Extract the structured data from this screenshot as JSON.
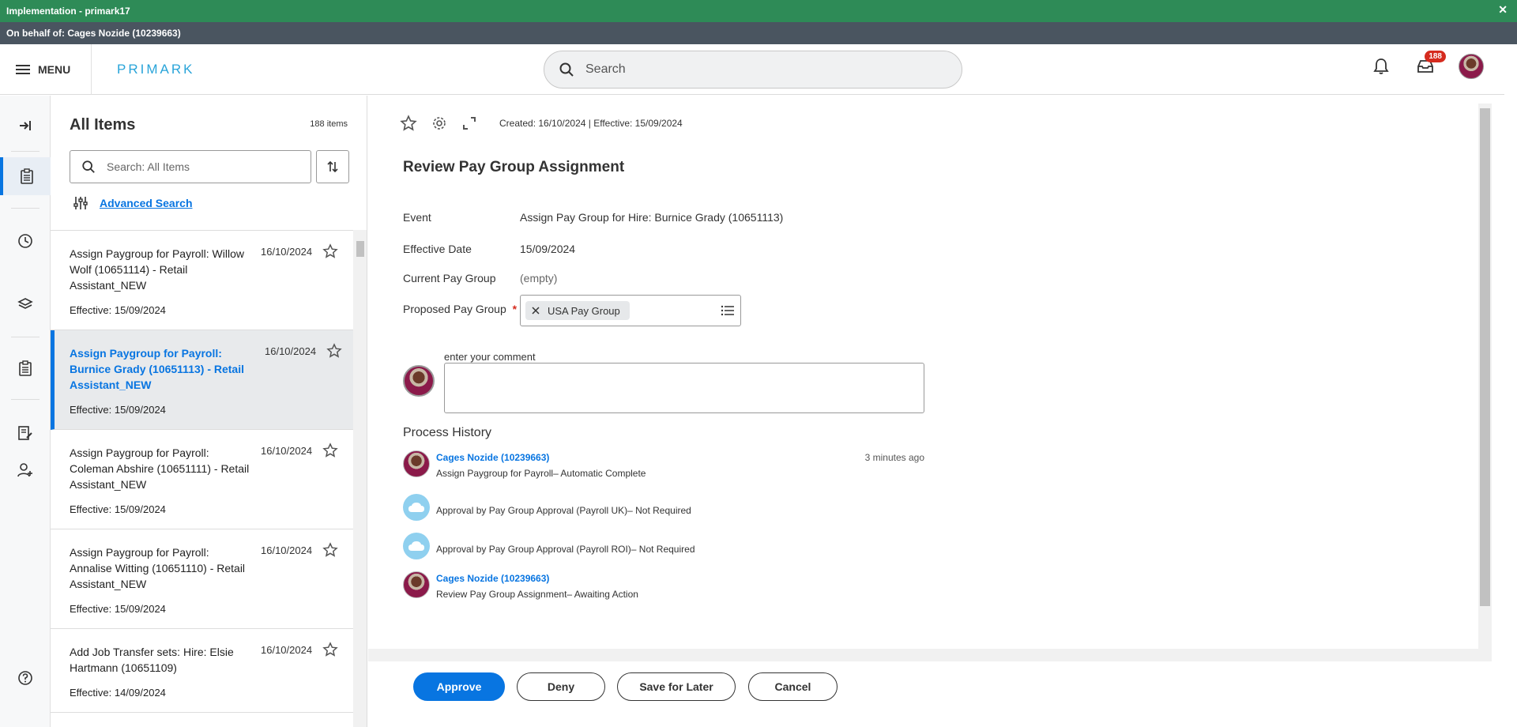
{
  "env": {
    "title": "Implementation - primark17",
    "close": "✕"
  },
  "behalf": {
    "text": "On behalf of: Cages Nozide (10239663)"
  },
  "header": {
    "menu_label": "MENU",
    "logo": "PRIMARK",
    "search_placeholder": "Search",
    "inbox_badge": "188"
  },
  "list": {
    "title": "All Items",
    "count": "188 items",
    "search_placeholder": "Search: All Items",
    "advanced_search": "Advanced Search",
    "items": [
      {
        "title": "Assign Paygroup for Payroll: Willow Wolf (10651114) - Retail Assistant_NEW",
        "date": "16/10/2024",
        "effective": "Effective: 15/09/2024"
      },
      {
        "title": "Assign Paygroup for Payroll: Burnice Grady (10651113) - Retail Assistant_NEW",
        "date": "16/10/2024",
        "effective": "Effective: 15/09/2024"
      },
      {
        "title": "Assign Paygroup for Payroll: Coleman Abshire (10651111) - Retail Assistant_NEW",
        "date": "16/10/2024",
        "effective": "Effective: 15/09/2024"
      },
      {
        "title": "Assign Paygroup for Payroll: Annalise Witting (10651110) - Retail Assistant_NEW",
        "date": "16/10/2024",
        "effective": "Effective: 15/09/2024"
      },
      {
        "title": "Add Job Transfer sets: Hire: Elsie Hartmann (10651109)",
        "date": "16/10/2024",
        "effective": "Effective: 14/09/2024"
      }
    ]
  },
  "detail": {
    "meta": "Created: 16/10/2024 | Effective: 15/09/2024",
    "title": "Review Pay Group Assignment",
    "event_label": "Event",
    "event_value": "Assign Pay Group for Hire: Burnice Grady (10651113)",
    "effective_label": "Effective Date",
    "effective_value": "15/09/2024",
    "current_label": "Current Pay Group",
    "current_value": "(empty)",
    "proposed_label": "Proposed Pay Group",
    "required_mark": "*",
    "proposed_value": "USA Pay Group",
    "comment_label": "enter your comment",
    "history_title": "Process History",
    "history": [
      {
        "who": "Cages Nozide (10239663)",
        "what": "Assign Paygroup for Payroll– Automatic Complete",
        "when": "3 minutes ago"
      },
      {
        "who": "",
        "what": "Approval by Pay Group Approval (Payroll UK)– Not Required",
        "when": ""
      },
      {
        "who": "",
        "what": "Approval by Pay Group Approval (Payroll ROI)– Not Required",
        "when": ""
      },
      {
        "who": "Cages Nozide (10239663)",
        "what": "Review Pay Group Assignment– Awaiting Action",
        "when": ""
      }
    ]
  },
  "footer": {
    "approve": "Approve",
    "deny": "Deny",
    "save_later": "Save for Later",
    "cancel": "Cancel"
  }
}
